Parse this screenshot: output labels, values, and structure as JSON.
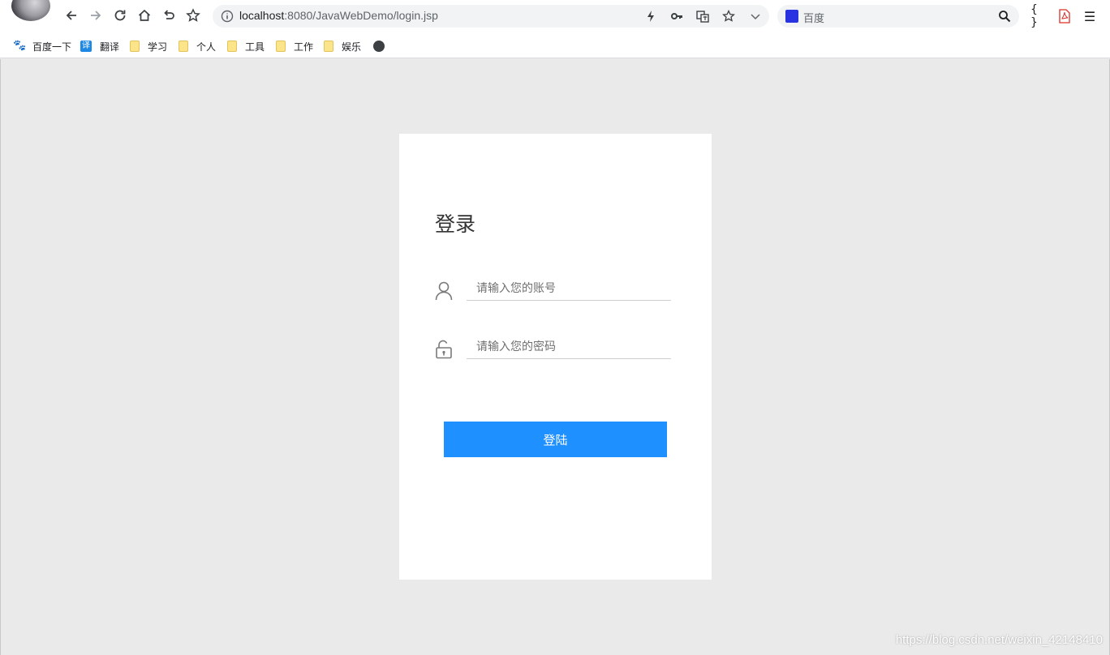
{
  "browser": {
    "url_host": "localhost",
    "url_rest": ":8080/JavaWebDemo/login.jsp",
    "search_placeholder": "百度",
    "devtools_label": "{ }",
    "menu_label": "☰"
  },
  "bookmarks": [
    {
      "label": "百度一下",
      "icon": "baidu-icon"
    },
    {
      "label": "翻译",
      "icon": "translate-icon",
      "icon_text": "译"
    },
    {
      "label": "学习",
      "icon": "folder-icon"
    },
    {
      "label": "个人",
      "icon": "folder-icon"
    },
    {
      "label": "工具",
      "icon": "folder-icon"
    },
    {
      "label": "工作",
      "icon": "folder-icon"
    },
    {
      "label": "娱乐",
      "icon": "folder-icon"
    },
    {
      "label": "",
      "icon": "globe-icon"
    }
  ],
  "login": {
    "title": "登录",
    "username_placeholder": "请输入您的账号",
    "password_placeholder": "请输入您的密码",
    "submit_label": "登陆"
  },
  "watermark": "https://blog.csdn.net/weixin_42148410",
  "colors": {
    "button": "#1e90ff",
    "page_bg": "#eaeaea",
    "card_bg": "#ffffff"
  }
}
